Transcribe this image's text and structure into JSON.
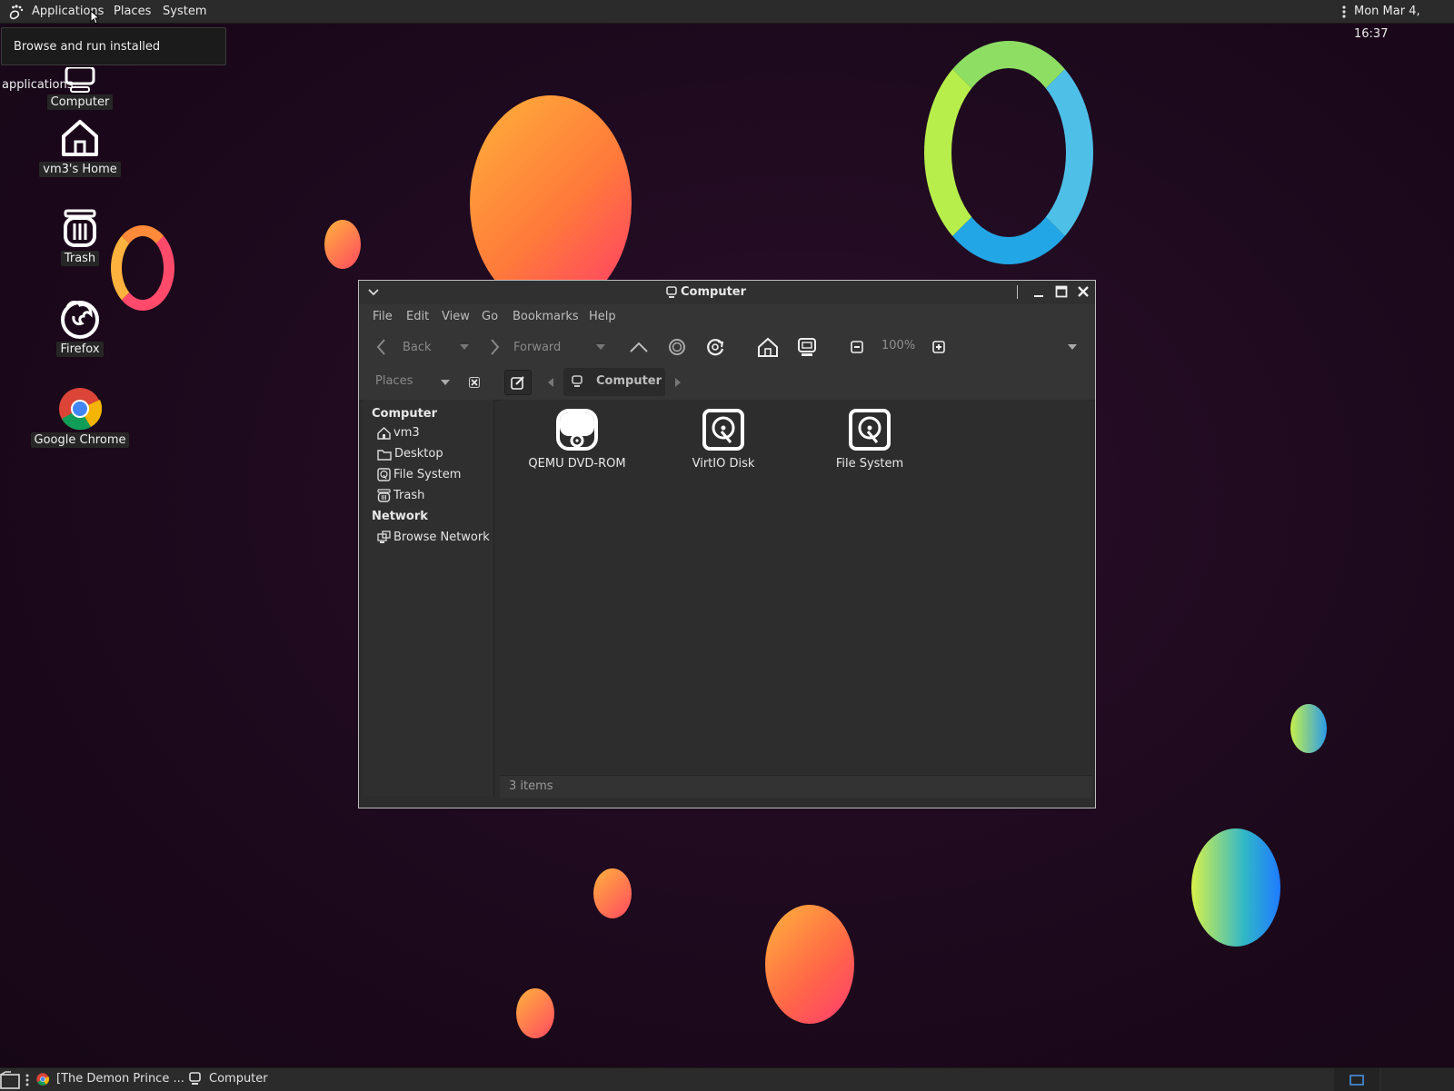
{
  "top_panel": {
    "menus": [
      "Applications",
      "Places",
      "System"
    ],
    "clock": "Mon Mar  4, 16:37"
  },
  "tooltip": "Browse and run installed applications",
  "desktop": {
    "icons": [
      {
        "label": "Computer",
        "icon": "computer-icon"
      },
      {
        "label": "vm3's Home",
        "icon": "home-icon"
      },
      {
        "label": "Trash",
        "icon": "trash-icon"
      },
      {
        "label": "Firefox",
        "icon": "firefox-icon"
      },
      {
        "label": "Google Chrome",
        "icon": "chrome-icon"
      }
    ]
  },
  "window": {
    "title": "Computer",
    "menu": [
      "File",
      "Edit",
      "View",
      "Go",
      "Bookmarks",
      "Help"
    ],
    "toolbar": {
      "back_label": "Back",
      "forward_label": "Forward",
      "zoom": "100%"
    },
    "location": {
      "places_label": "Places",
      "crumb": "Computer"
    },
    "sidebar": {
      "sections": [
        {
          "title": "Computer",
          "items": [
            "vm3",
            "Desktop",
            "File System",
            "Trash"
          ]
        },
        {
          "title": "Network",
          "items": [
            "Browse Network"
          ]
        }
      ]
    },
    "files": [
      {
        "label": "QEMU DVD-ROM",
        "icon": "dvd-drive-icon"
      },
      {
        "label": "VirtIO Disk",
        "icon": "hard-disk-icon"
      },
      {
        "label": "File System",
        "icon": "hard-disk-icon"
      }
    ],
    "status": "3 items"
  },
  "taskbar": {
    "tasks": [
      "[The Demon Prince ...",
      "Computer"
    ]
  },
  "colors": {
    "panel": "#2b2b2b",
    "desktop_bg": "#1e0b1e",
    "window_bg": "#2d2d2d"
  }
}
